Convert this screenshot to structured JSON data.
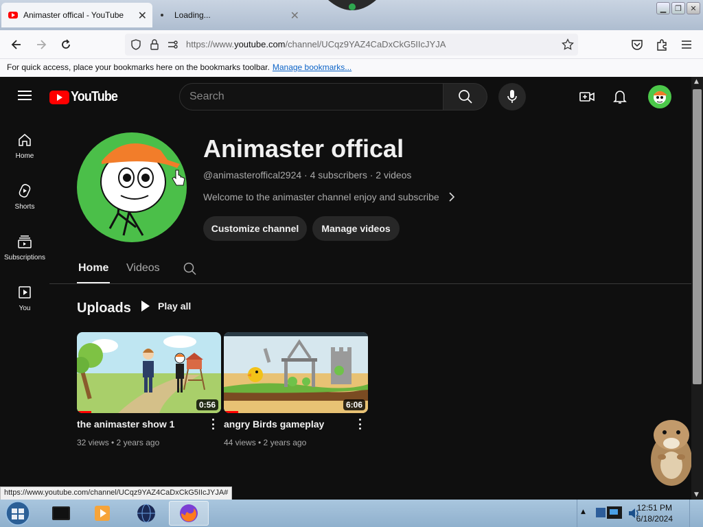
{
  "browser": {
    "tabs": [
      {
        "title": "Animaster offical - YouTube",
        "active": true
      },
      {
        "title": "Loading...",
        "active": false
      }
    ],
    "url_prefix": "https://www.",
    "url_domain": "youtube.com",
    "url_rest": "/channel/UCqz9YAZ4CaDxCkG5IIcJYJA",
    "bookmarks_bar_text": "For quick access, place your bookmarks here on the bookmarks toolbar.",
    "bookmarks_link": "Manage bookmarks...",
    "status_url": "https://www.youtube.com/channel/UCqz9YAZ4CaDxCkG5IIcJYJA#"
  },
  "youtube": {
    "logo_text": "YouTube",
    "search_placeholder": "Search",
    "sidebar": [
      {
        "label": "Home",
        "icon": "home-icon"
      },
      {
        "label": "Shorts",
        "icon": "shorts-icon"
      },
      {
        "label": "Subscriptions",
        "icon": "subscriptions-icon"
      },
      {
        "label": "You",
        "icon": "you-icon"
      }
    ],
    "channel": {
      "name": "Animaster offical",
      "meta": "@animasteroffical2924 · 4 subscribers · 2 videos",
      "description": "Welcome to the animaster channel enjoy and subscribe",
      "customize_label": "Customize channel",
      "manage_label": "Manage videos"
    },
    "tabs": [
      {
        "label": "Home",
        "active": true
      },
      {
        "label": "Videos",
        "active": false
      }
    ],
    "section_title": "Uploads",
    "play_all_label": "Play all",
    "videos": [
      {
        "title": "the animaster show 1",
        "meta": "32 views • 2 years ago",
        "duration": "0:56",
        "watched": 0.1
      },
      {
        "title": "angry Birds gameplay",
        "meta": "44 views • 2 years ago",
        "duration": "6:06",
        "watched": 0.1
      }
    ]
  },
  "taskbar": {
    "time": "12:51 PM",
    "date": "6/18/2024"
  },
  "colors": {
    "yt_bg": "#0f0f0f",
    "yt_red": "#ff0000",
    "avatar_green": "#4bbf49"
  }
}
